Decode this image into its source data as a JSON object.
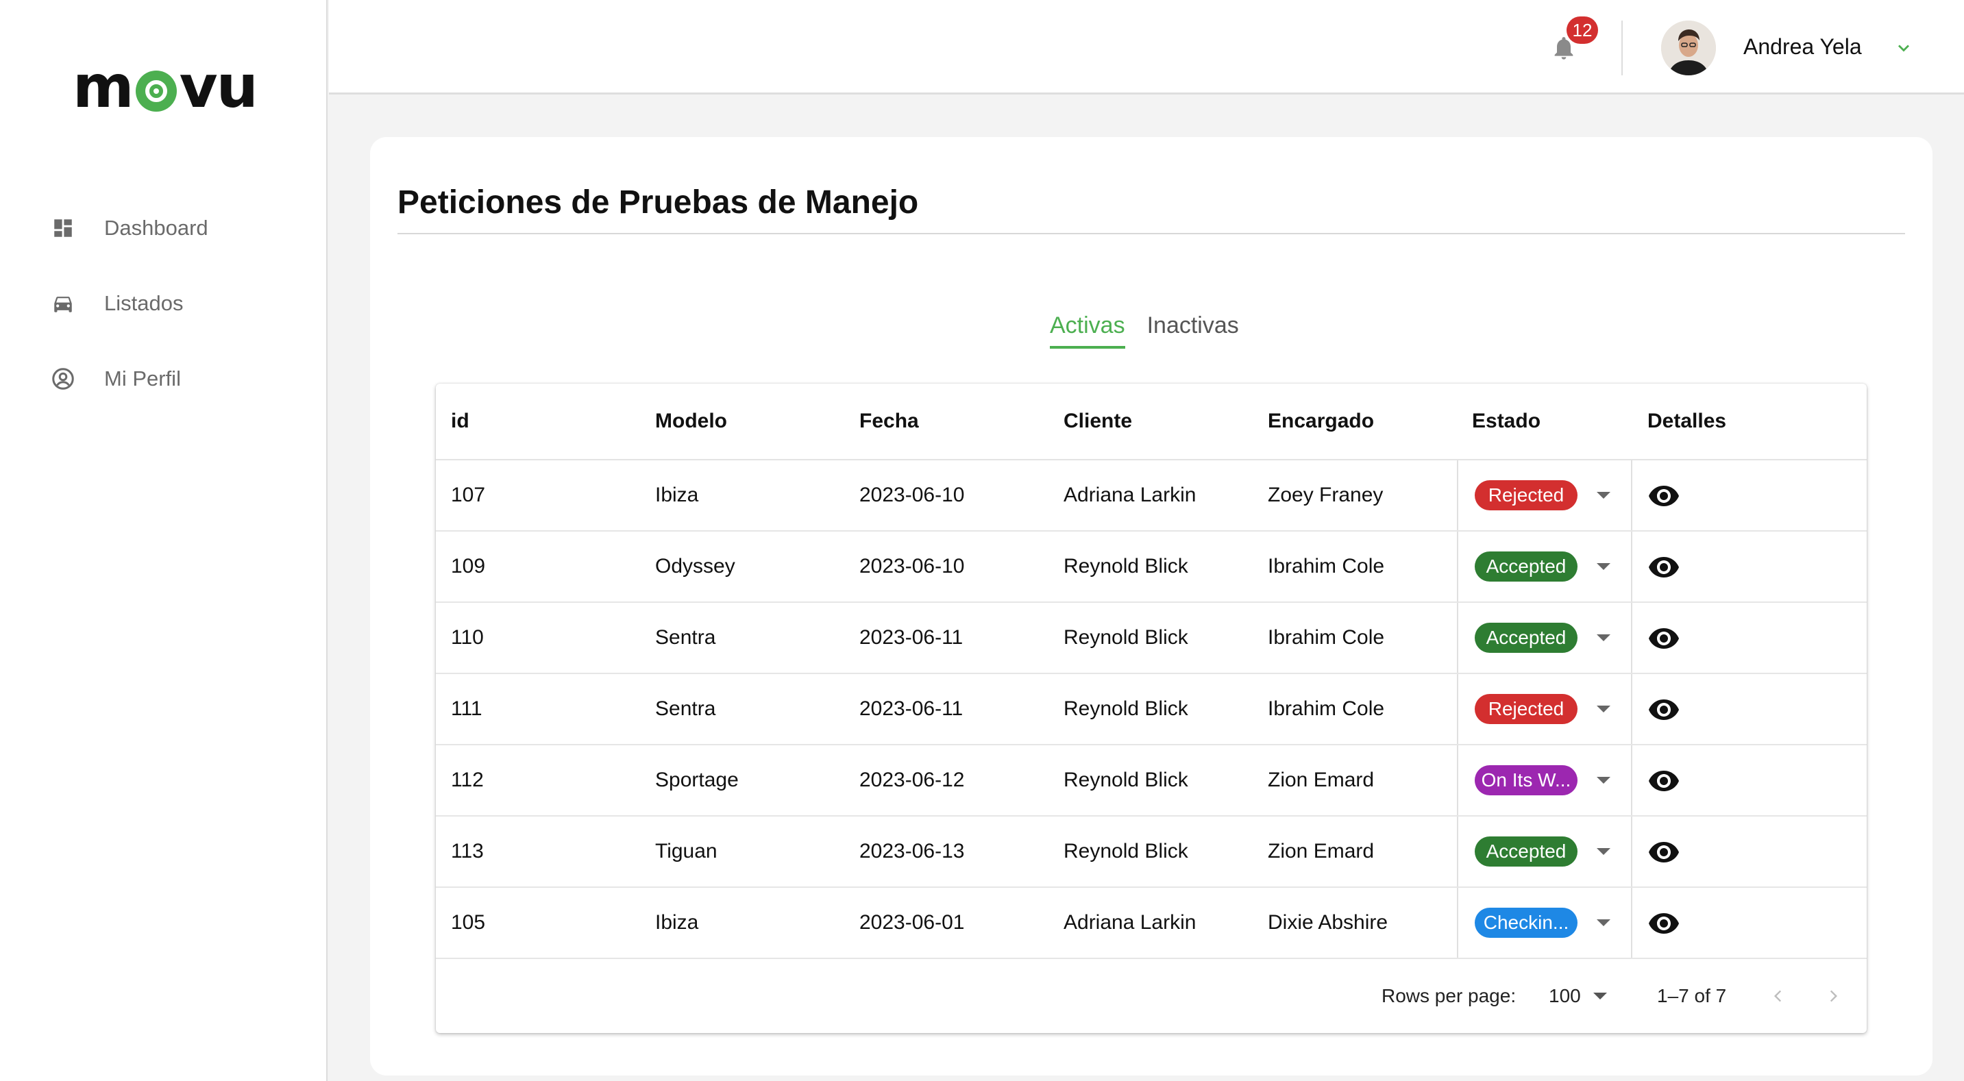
{
  "sidebar": {
    "logo_text": "movu",
    "items": [
      {
        "label": "Dashboard",
        "icon": "dashboard-icon"
      },
      {
        "label": "Listados",
        "icon": "car-icon"
      },
      {
        "label": "Mi Perfil",
        "icon": "account-circle-icon"
      }
    ]
  },
  "header": {
    "notifications_count": "12",
    "user_name": "Andrea Yela"
  },
  "main": {
    "title": "Peticiones de Pruebas de Manejo",
    "tabs": [
      {
        "label": "Activas",
        "active": true
      },
      {
        "label": "Inactivas",
        "active": false
      }
    ],
    "table": {
      "columns": [
        "id",
        "Modelo",
        "Fecha",
        "Cliente",
        "Encargado",
        "Estado",
        "Detalles"
      ],
      "rows": [
        {
          "id": "107",
          "modelo": "Ibiza",
          "fecha": "2023-06-10",
          "cliente": "Adriana Larkin",
          "encargado": "Zoey Franey",
          "estado": "Rejected",
          "estado_color": "#d32f2f"
        },
        {
          "id": "109",
          "modelo": "Odyssey",
          "fecha": "2023-06-10",
          "cliente": "Reynold Blick",
          "encargado": "Ibrahim Cole",
          "estado": "Accepted",
          "estado_color": "#2e7d32"
        },
        {
          "id": "110",
          "modelo": "Sentra",
          "fecha": "2023-06-11",
          "cliente": "Reynold Blick",
          "encargado": "Ibrahim Cole",
          "estado": "Accepted",
          "estado_color": "#2e7d32"
        },
        {
          "id": "111",
          "modelo": "Sentra",
          "fecha": "2023-06-11",
          "cliente": "Reynold Blick",
          "encargado": "Ibrahim Cole",
          "estado": "Rejected",
          "estado_color": "#d32f2f"
        },
        {
          "id": "112",
          "modelo": "Sportage",
          "fecha": "2023-06-12",
          "cliente": "Reynold Blick",
          "encargado": "Zion Emard",
          "estado": "On Its W...",
          "estado_color": "#9c27b0"
        },
        {
          "id": "113",
          "modelo": "Tiguan",
          "fecha": "2023-06-13",
          "cliente": "Reynold Blick",
          "encargado": "Zion Emard",
          "estado": "Accepted",
          "estado_color": "#2e7d32"
        },
        {
          "id": "105",
          "modelo": "Ibiza",
          "fecha": "2023-06-01",
          "cliente": "Adriana Larkin",
          "encargado": "Dixie Abshire",
          "estado": "Checkin...",
          "estado_color": "#1e88e5"
        }
      ]
    },
    "pagination": {
      "rows_per_page_label": "Rows per page:",
      "rows_per_page_value": "100",
      "range_text": "1–7 of 7"
    }
  },
  "colors": {
    "accent": "#4caf50",
    "badge": "#d32f2f"
  }
}
